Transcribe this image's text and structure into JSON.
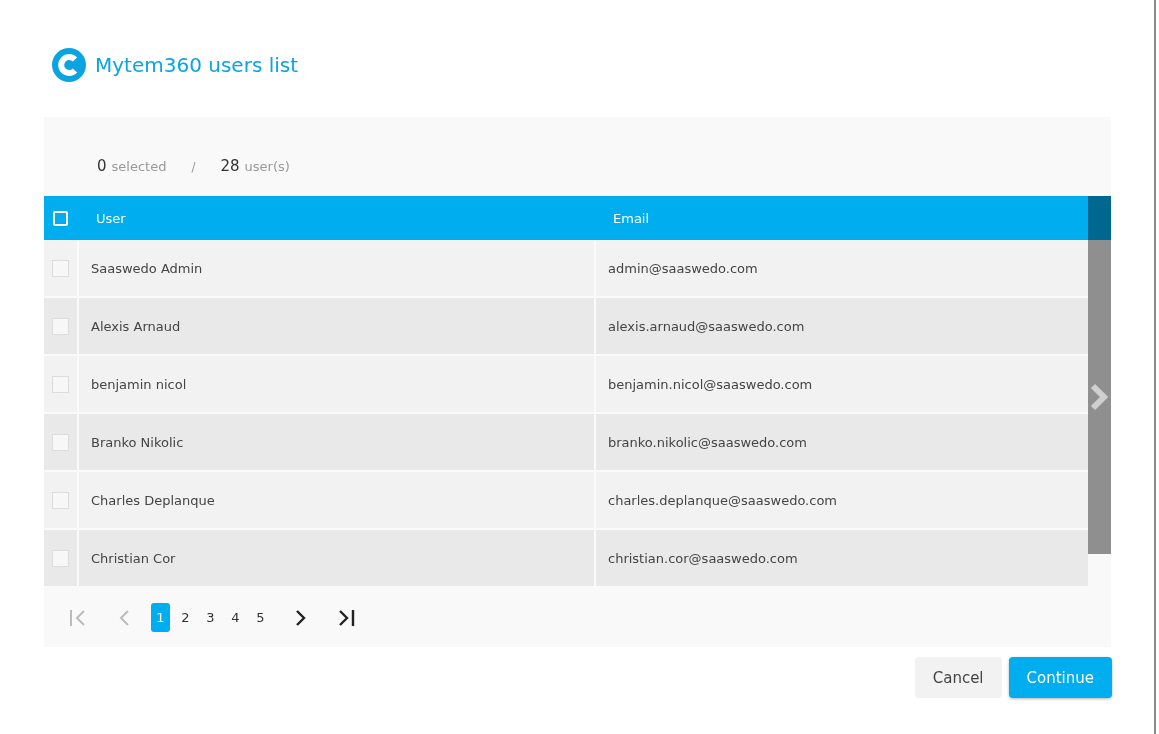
{
  "dialog": {
    "title": "Mytem360 users list"
  },
  "summary": {
    "selected_count": "0",
    "selected_label": "selected",
    "separator": "/",
    "total_count": "28",
    "total_label": "user(s)"
  },
  "table": {
    "select_all": {
      "checked": false
    },
    "columns": [
      "User",
      "Email"
    ],
    "rows": [
      {
        "user": "Saaswedo Admin",
        "email": "admin@saaswedo.com",
        "checked": false
      },
      {
        "user": "Alexis Arnaud",
        "email": "alexis.arnaud@saaswedo.com",
        "checked": false
      },
      {
        "user": "benjamin nicol",
        "email": "benjamin.nicol@saaswedo.com",
        "checked": false
      },
      {
        "user": "Branko Nikolic",
        "email": "branko.nikolic@saaswedo.com",
        "checked": false
      },
      {
        "user": "Charles Deplanque",
        "email": "charles.deplanque@saaswedo.com",
        "checked": false
      },
      {
        "user": "Christian Cor",
        "email": "christian.cor@saaswedo.com",
        "checked": false
      }
    ]
  },
  "pagination": {
    "first": {
      "disabled": true
    },
    "prev": {
      "disabled": true
    },
    "pages": [
      {
        "label": "1",
        "selected": true
      },
      {
        "label": "2",
        "selected": false
      },
      {
        "label": "3",
        "selected": false
      },
      {
        "label": "4",
        "selected": false
      },
      {
        "label": "5",
        "selected": false
      }
    ],
    "next": {
      "disabled": false
    },
    "last": {
      "disabled": false
    }
  },
  "buttons": [
    {
      "label": "Cancel",
      "kind": "secondary"
    },
    {
      "label": "Continue",
      "kind": "primary"
    }
  ]
}
